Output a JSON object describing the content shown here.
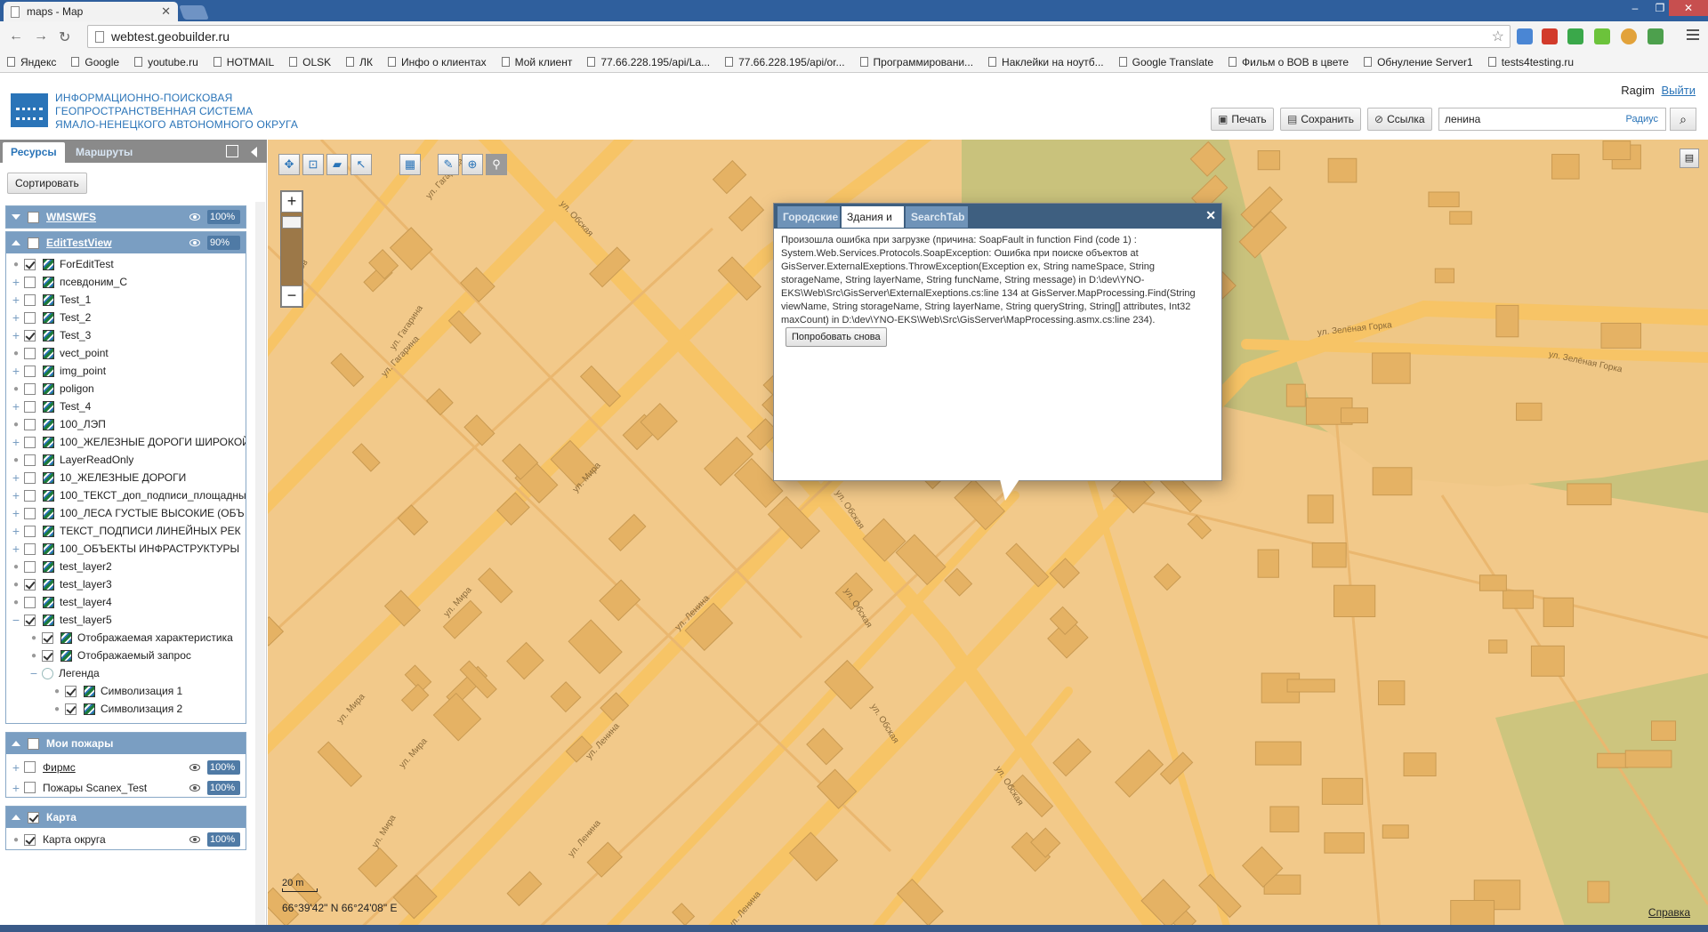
{
  "browser": {
    "tab_title": "maps - Map",
    "url": "webtest.geobuilder.ru",
    "bookmarks": [
      "Яндекс",
      "Google",
      "youtube.ru",
      "HOTMAIL",
      "OLSK",
      "ЛК",
      "Инфо о клиентах",
      "Мой клиент",
      "77.66.228.195/api/La...",
      "77.66.228.195/api/or...",
      "Программировани...",
      "Наклейки на ноутб...",
      "Google Translate",
      "Фильм о ВОВ в цвете",
      "Обнуление Server1",
      "tests4testing.ru"
    ]
  },
  "header": {
    "title_line1": "ИНФОРМАЦИОННО-ПОИСКОВАЯ",
    "title_line2": "ГЕОПРОСТРАНСТВЕННАЯ СИСТЕМА",
    "title_line3": "ЯМАЛО-НЕНЕЦКОГО АВТОНОМНОГО ОКРУГА",
    "user": "Ragim",
    "logout": "Выйти",
    "print": "Печать",
    "save": "Сохранить",
    "link": "Ссылка",
    "search_value": "ленина",
    "radius": "Радиус"
  },
  "panel": {
    "tab_resources": "Ресурсы",
    "tab_routes": "Маршруты",
    "sort": "Сортировать",
    "groups": {
      "wms": {
        "name": "WMSWFS",
        "pct": "100%"
      },
      "edit": {
        "name": "EditTestView",
        "pct": "90%",
        "layers": [
          {
            "name": "ForEditTest",
            "checked": true,
            "exp": "dot"
          },
          {
            "name": "псевдоним_С",
            "checked": false,
            "exp": "+"
          },
          {
            "name": "Test_1",
            "checked": false,
            "exp": "+"
          },
          {
            "name": "Test_2",
            "checked": false,
            "exp": "+"
          },
          {
            "name": "Test_3",
            "checked": true,
            "exp": "+"
          },
          {
            "name": "vect_point",
            "checked": false,
            "exp": "dot"
          },
          {
            "name": "img_point",
            "checked": false,
            "exp": "+"
          },
          {
            "name": "poligon",
            "checked": false,
            "exp": "dot"
          },
          {
            "name": "Test_4",
            "checked": false,
            "exp": "+"
          },
          {
            "name": "100_ЛЭП",
            "checked": false,
            "exp": "dot"
          },
          {
            "name": "100_ЖЕЛЕЗНЫЕ ДОРОГИ ШИРОКОЙ",
            "checked": false,
            "exp": "+"
          },
          {
            "name": "LayerReadOnly",
            "checked": false,
            "exp": "dot"
          },
          {
            "name": "10_ЖЕЛЕЗНЫЕ ДОРОГИ",
            "checked": false,
            "exp": "+"
          },
          {
            "name": "100_ТЕКСТ_доп_подписи_площадны",
            "checked": false,
            "exp": "+"
          },
          {
            "name": "100_ЛЕСА ГУСТЫЕ ВЫСОКИЕ (ОБЪ",
            "checked": false,
            "exp": "+"
          },
          {
            "name": "ТЕКСТ_ПОДПИСИ ЛИНЕЙНЫХ РЕК",
            "checked": false,
            "exp": "+"
          },
          {
            "name": "100_ОБЪЕКТЫ ИНФРАСТРУКТУРЫ",
            "checked": false,
            "exp": "+"
          },
          {
            "name": "test_layer2",
            "checked": false,
            "exp": "dot"
          },
          {
            "name": "test_layer3",
            "checked": true,
            "exp": "dot"
          },
          {
            "name": "test_layer4",
            "checked": false,
            "exp": "dot"
          },
          {
            "name": "test_layer5",
            "checked": true,
            "exp": "−"
          }
        ],
        "sub": {
          "char": "Отображаемая характеристика",
          "query": "Отображаемый запрос",
          "legend": "Легенда",
          "sym1": "Символизация 1",
          "sym2": "Символизация 2"
        }
      },
      "fires": {
        "name": "Мои пожары",
        "layers": [
          {
            "name": "Фирмс",
            "pct": "100%"
          },
          {
            "name": "Пожары Scanex_Test",
            "pct": "100%"
          }
        ]
      },
      "map": {
        "name": "Карта",
        "layers": [
          {
            "name": "Карта округа",
            "pct": "100%"
          }
        ]
      }
    }
  },
  "map": {
    "zoom_in": "+",
    "zoom_out": "−",
    "scale": "20 m",
    "coords": "66°39'42\" N 66°24'08\" E",
    "help": "Справка",
    "streets": [
      "ул. Гагарина",
      "ул. Обская",
      "ул. Гагарина",
      "ул. Мира",
      "ул. Мира",
      "ул. Мира",
      "ул. Зелёная Горка",
      "ул. Зелёная Горка",
      "ул. Зелёная",
      "ул. Обская",
      "ул. Ленина",
      "ул. Мира",
      "ул. Ленина",
      "ул. Обская",
      "ул. Мира",
      "ул. Ленина",
      "ул. Обская",
      "ул. Обская",
      "Вологов",
      "ул. Гагарина",
      "ул. Ленина"
    ]
  },
  "popup": {
    "tab1": "Городские",
    "tab2": "Здания и",
    "tab3": "SearchTab",
    "error_text": "Произошла ошибка при загрузке (причина: SoapFault in function Find (code 1) : System.Web.Services.Protocols.SoapException: Ошибка при поиске объектов at GisServer.ExternalExeptions.ThrowException(Exception ex, String nameSpace, String storageName, String layerName, String funcName, String message) in D:\\dev\\YNO-EKS\\Web\\Src\\GisServer\\ExternalExeptions.cs:line 134 at GisServer.MapProcessing.Find(String viewName, String storageName, String layerName, String queryString, String[] attributes, Int32 maxCount) in D:\\dev\\YNO-EKS\\Web\\Src\\GisServer\\MapProcessing.asmx.cs:line 234).",
    "retry": "Попробовать снова"
  },
  "colors": {
    "accent": "#2a74b8",
    "map_bg": "#f2c98a",
    "road": "#f6c264",
    "building": "#e7b263",
    "forest": "#c6c07a"
  }
}
